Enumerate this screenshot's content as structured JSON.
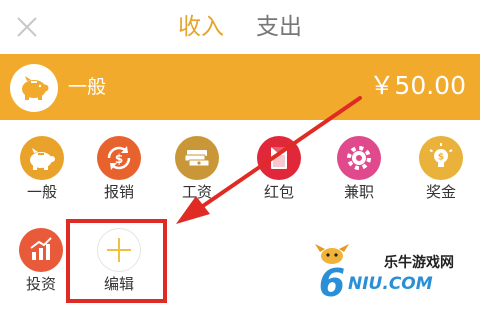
{
  "header": {
    "close_icon": "close-icon",
    "tabs": [
      {
        "label": "收入",
        "active": true
      },
      {
        "label": "支出",
        "active": false
      }
    ]
  },
  "summary": {
    "category_label": "一般",
    "amount": "￥50.00",
    "icon": "piggy-bank-icon",
    "background_color": "#f2aa2c"
  },
  "categories": [
    {
      "label": "一般",
      "icon": "piggy-bank-icon",
      "color": "#e9a22a"
    },
    {
      "label": "报销",
      "icon": "reimburse-icon",
      "color": "#e8622e"
    },
    {
      "label": "工资",
      "icon": "money-stack-icon",
      "color": "#c99738"
    },
    {
      "label": "红包",
      "icon": "red-envelope-icon",
      "color": "#e0283a"
    },
    {
      "label": "兼职",
      "icon": "gear-icon",
      "color": "#e04a8c"
    },
    {
      "label": "奖金",
      "icon": "lightbulb-icon",
      "color": "#eab23a"
    },
    {
      "label": "投资",
      "icon": "bar-chart-icon",
      "color": "#e85a3a"
    },
    {
      "label": "编辑",
      "icon": "plus-icon",
      "color": "#f0c040"
    }
  ],
  "annotation": {
    "highlight_color": "#e02b24"
  },
  "watermark": {
    "logo_mark": "6",
    "site_name": "乐牛游戏网",
    "domain": "NIU.COM"
  }
}
